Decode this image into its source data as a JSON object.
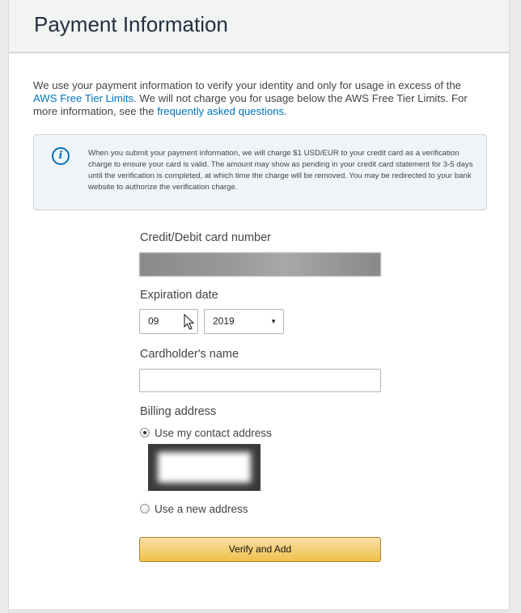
{
  "header": {
    "title": "Payment Information"
  },
  "intro": {
    "text_before_link1": "We use your payment information to verify your identity and only for usage in excess of the ",
    "link1": "AWS Free Tier Limits",
    "text_between": ". We will not charge you for usage below the AWS Free Tier Limits. For more information, see the ",
    "link2": "frequently asked questions",
    "text_after": "."
  },
  "info": {
    "icon": "info-icon",
    "text": "When you submit your payment information, we will charge $1 USD/EUR to your credit card as a verification charge to ensure your card is valid. The amount may show as pending in your credit card statement for 3-5 days until the verification is completed, at which time the charge will be removed. You may be redirected to your bank website to authorize the verification charge."
  },
  "form": {
    "card_number_label": "Credit/Debit card number",
    "expiration_label": "Expiration date",
    "expiration_month": "09",
    "expiration_year": "2019",
    "cardholder_label": "Cardholder's name",
    "cardholder_value": "",
    "billing_label": "Billing address",
    "option_contact": "Use my contact address",
    "option_new": "Use a new address",
    "selected_option": "contact",
    "submit_label": "Verify and Add"
  },
  "colors": {
    "link": "#0073bb",
    "button_top": "#f7dfa5",
    "button_bottom": "#f0c14b",
    "info_bg": "#f1f4f7"
  }
}
